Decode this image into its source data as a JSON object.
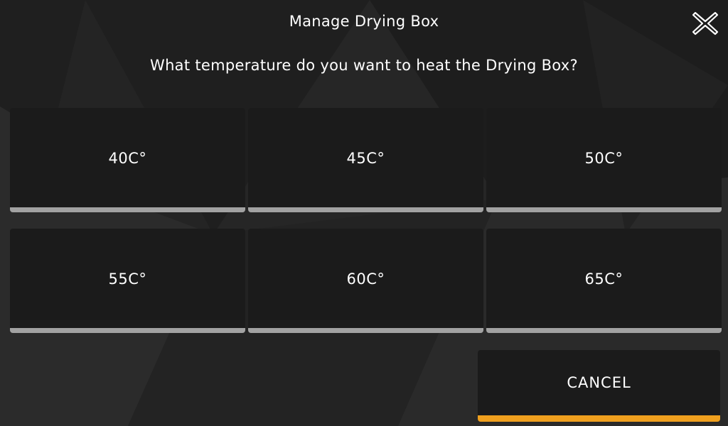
{
  "dialog": {
    "title": "Manage Drying Box",
    "question": "What temperature do you want to heat the Drying Box?",
    "close_icon": "close-x-icon"
  },
  "temperatures": [
    {
      "label": "40C°"
    },
    {
      "label": "45C°"
    },
    {
      "label": "50C°"
    },
    {
      "label": "55C°"
    },
    {
      "label": "60C°"
    },
    {
      "label": "65C°"
    }
  ],
  "actions": {
    "cancel_label": "CANCEL"
  },
  "colors": {
    "background": "#252525",
    "button_bg": "#1b1b1b",
    "button_underline": "#a2a2a2",
    "cancel_accent": "#f0a01e",
    "text": "#ffffff"
  }
}
